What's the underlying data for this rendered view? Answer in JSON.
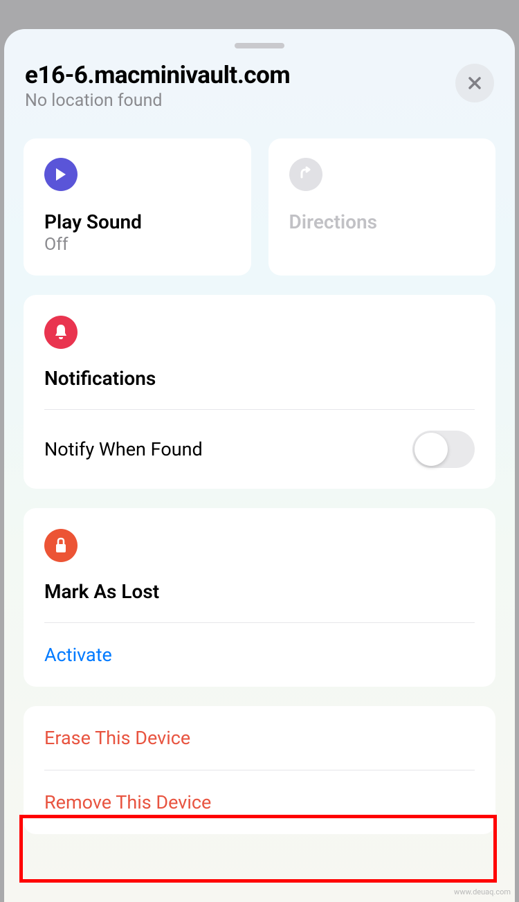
{
  "header": {
    "title": "e16-6.macminivault.com",
    "subtitle": "No location found"
  },
  "actions": {
    "playSound": {
      "title": "Play Sound",
      "status": "Off"
    },
    "directions": {
      "title": "Directions"
    }
  },
  "notifications": {
    "title": "Notifications",
    "notifyWhenFound": {
      "label": "Notify When Found",
      "enabled": false
    }
  },
  "markAsLost": {
    "title": "Mark As Lost",
    "activateLabel": "Activate"
  },
  "destructive": {
    "erase": "Erase This Device",
    "remove": "Remove This Device"
  },
  "watermark": "www.deuaq.com"
}
